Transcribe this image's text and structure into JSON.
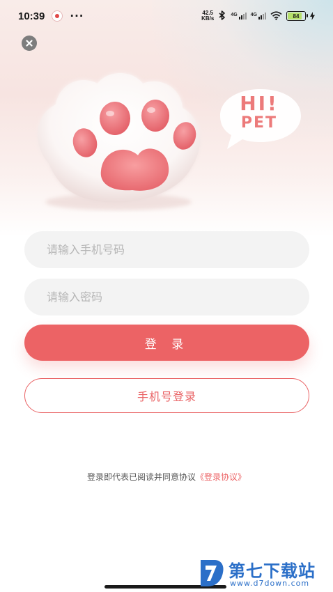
{
  "status_bar": {
    "time": "10:39",
    "more_dots": "···",
    "net_speed_value": "42.5",
    "net_speed_unit": "KB/s",
    "sim1_tag": "4G",
    "sim2_tag": "4G",
    "battery_level": "84",
    "battery_fill_fraction": 0.84
  },
  "icons": {
    "close": "close-icon",
    "app_notification": "app-notification-icon",
    "bluetooth": "bluetooth-icon",
    "wifi": "wifi-icon",
    "charging": "charging-bolt-icon",
    "watermark_logo": "d7-logo-icon"
  },
  "hero": {
    "bubble_line1": "HI!",
    "bubble_line2": "PET"
  },
  "form": {
    "phone_placeholder": "请输入手机号码",
    "phone_value": "",
    "password_placeholder": "请输入密码",
    "password_value": "",
    "login_label": "登 录",
    "phone_login_label": "手机号登录"
  },
  "agreement": {
    "text": "登录即代表已阅读并同意协议",
    "link": "《登录协议》"
  },
  "watermark": {
    "title": "第七下载站",
    "url": "www.d7down.com"
  },
  "colors": {
    "accent": "#ec6365",
    "input_bg": "#f3f3f3",
    "placeholder": "#b5b5b5",
    "watermark_blue": "#2b6fc8"
  }
}
